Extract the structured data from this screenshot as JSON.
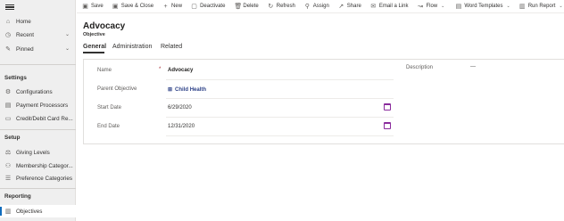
{
  "sidebar": {
    "top_items": [
      {
        "label": "Home",
        "icon": "home-icon"
      },
      {
        "label": "Recent",
        "icon": "clock-icon"
      },
      {
        "label": "Pinned",
        "icon": "pin-icon"
      }
    ],
    "sections": [
      {
        "title": "Settings",
        "items": [
          "Configurations",
          "Payment Processors",
          "Credit/Debit Card Re..."
        ]
      },
      {
        "title": "Setup",
        "items": [
          "Giving Levels",
          "Membership Categor...",
          "Preference Categories"
        ]
      },
      {
        "title": "Reporting",
        "items": [
          "Objectives"
        ]
      }
    ]
  },
  "commands": {
    "save": "Save",
    "save_close": "Save & Close",
    "new": "New",
    "deactivate": "Deactivate",
    "delete": "Delete",
    "refresh": "Refresh",
    "assign": "Assign",
    "share": "Share",
    "email_link": "Email a Link",
    "flow": "Flow",
    "word_templates": "Word Templates",
    "run_report": "Run Report"
  },
  "record": {
    "title": "Advocacy",
    "entity": "Objective"
  },
  "tabs": [
    "General",
    "Administration",
    "Related"
  ],
  "form": {
    "name_label": "Name",
    "name_required": "*",
    "name_value": "Advocacy",
    "parent_label": "Parent Objective",
    "parent_value": "Child Health",
    "start_label": "Start Date",
    "start_value": "6/29/2020",
    "end_label": "End Date",
    "end_value": "12/31/2020",
    "description_label": "Description",
    "description_value": "---"
  },
  "colors": {
    "accent": "#0f6cbd",
    "link": "#2b3f86",
    "calendar": "#8a2b9c",
    "sidebar_bg": "#efefef"
  }
}
